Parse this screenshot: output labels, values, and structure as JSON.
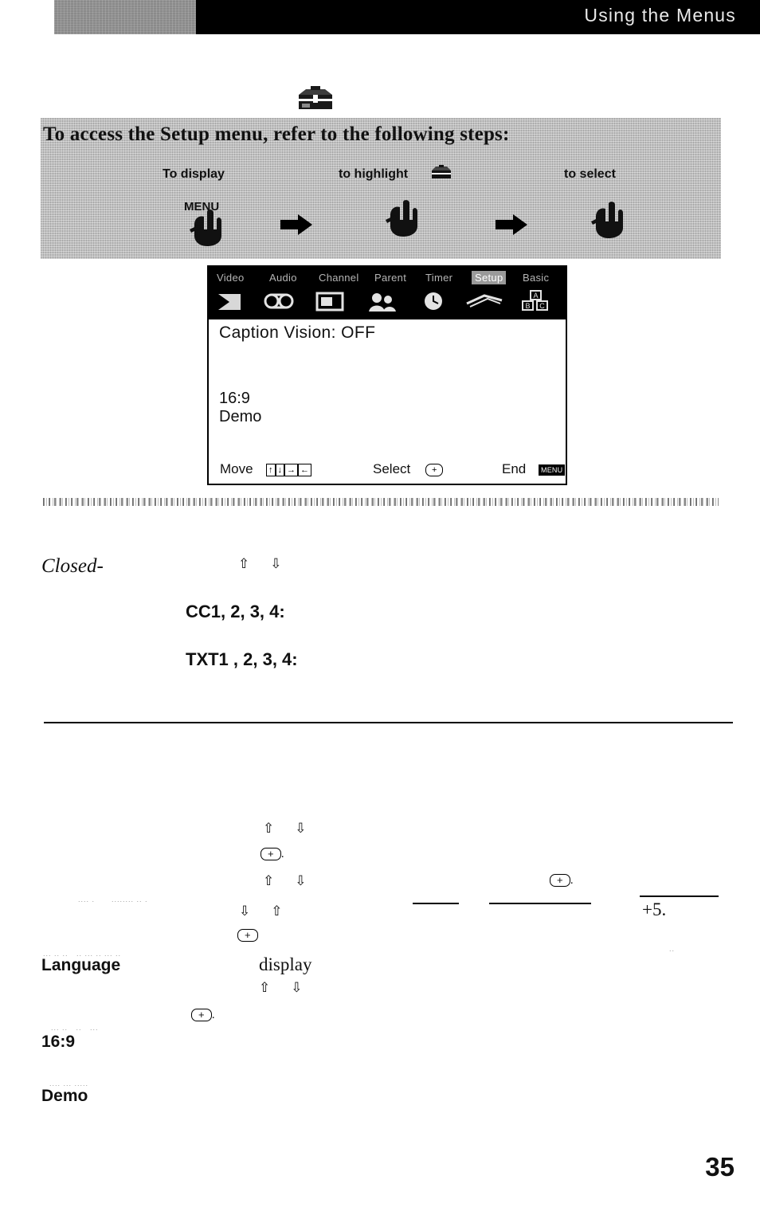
{
  "header": {
    "title": "Using the Menus"
  },
  "panel": {
    "heading": "To access the Setup menu, refer to the following steps:",
    "step1_label": "To display",
    "step2_label": "to highlight",
    "step3_label": "to select",
    "menu_button_label": "MENU",
    "icons": {
      "toolbox": "toolbox-icon",
      "highlight_target": "toolbox-icon",
      "hand": "pointing-hand-icon",
      "arrow": "right-arrow-icon"
    }
  },
  "tv": {
    "tabs": [
      {
        "label": "Video",
        "selected": false
      },
      {
        "label": "Audio",
        "selected": false
      },
      {
        "label": "Channel",
        "selected": false
      },
      {
        "label": "Parent",
        "selected": false
      },
      {
        "label": "Timer",
        "selected": false
      },
      {
        "label": "Setup",
        "selected": true
      },
      {
        "label": "Basic",
        "selected": false
      }
    ],
    "caption_line": "Caption Vision:  OFF",
    "ratio_line": "16:9",
    "demo_line": "Demo",
    "footer": {
      "move_label": "Move",
      "move_keys": "↑↓→←",
      "select_label": "Select",
      "select_key": "+",
      "end_label": "End",
      "end_key": "MENU"
    }
  },
  "body": {
    "closed_word": "Closed-",
    "cc_line": "CC1,  2, 3, 4:",
    "txt_line": "TXT1  , 2, 3, 4:",
    "language_label": "Language",
    "display_word": "display",
    "ratio_label": "16:9",
    "demo_label": "Demo",
    "plus_five": "+5.",
    "up_arrow": "⇧",
    "down_arrow": "⇩",
    "plus_key": "+",
    "plus_key_period": "."
  },
  "page": {
    "number": "35"
  },
  "colors": {
    "header_bg": "#000000",
    "panel_bg": "#b9b9b9",
    "text": "#111111",
    "header_text": "#e9e9e9"
  }
}
